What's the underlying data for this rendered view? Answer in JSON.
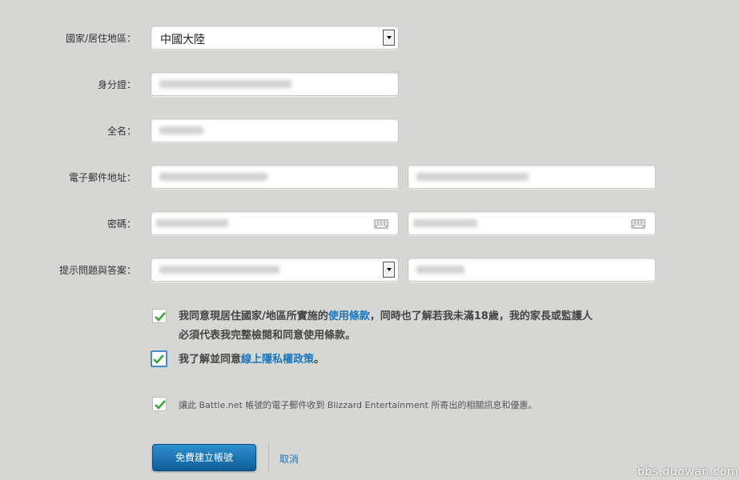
{
  "form": {
    "country_label": "國家/居住地區：",
    "country_value": "中國大陸",
    "id_label": "身分證：",
    "fullname_label": "全名：",
    "email_label": "電子郵件地址：",
    "password_label": "密碼：",
    "security_label": "提示問題與答案："
  },
  "agreements": {
    "terms_text_1": "我同意現居住國家/地區所實施的",
    "terms_link": "使用條款",
    "terms_text_2": "，同時也了解若我未滿18歲，我的家長或監護人",
    "terms_text_3": "必須代表我完整檢閱和同意使用條款。",
    "privacy_text_1": "我了解並同意",
    "privacy_link": "線上隱私權政策",
    "privacy_text_2": "。",
    "email_optin": "讓此 Battle.net 帳號的電子郵件收到 Blizzard Entertainment 所寄出的相關訊息和優惠。"
  },
  "actions": {
    "create_label": "免費建立帳號",
    "cancel_label": "取消"
  },
  "watermark": "bbs.duowan.com",
  "colors": {
    "background": "#d6d6d3",
    "link": "#1a75bb",
    "button": "#0d5d98",
    "check": "#3aa63a"
  }
}
